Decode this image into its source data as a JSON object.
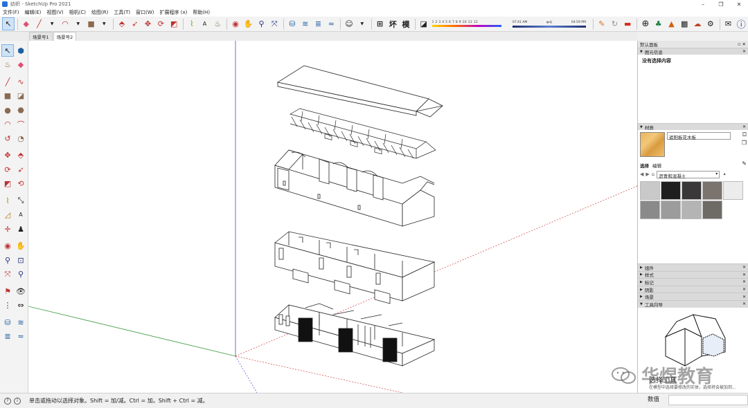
{
  "window": {
    "title": "纺织 - SketchUp Pro 2021",
    "controls": [
      "–",
      "❐",
      "✕"
    ]
  },
  "menu": [
    "文件(F)",
    "编辑(E)",
    "视图(V)",
    "相机(C)",
    "绘图(R)",
    "工具(T)",
    "窗口(W)",
    "扩展程序 (x)",
    "帮助(H)"
  ],
  "toolbar": {
    "shadow_months": "1 2 3 4 5 6 7 8 9 10 11 12",
    "time_start": "07:41 AM",
    "time_mid": "中午",
    "time_end": "04:59 PM",
    "text_buttons": [
      "⊞",
      "坏",
      "模"
    ]
  },
  "scene_tabs": [
    "场景号1",
    "场景号2"
  ],
  "tray": {
    "title": "默认面板",
    "entity_info": {
      "header": "图元信息",
      "body": "没有选择内容"
    },
    "materials": {
      "header": "材质",
      "name": "遮阳板花木板",
      "tabs": [
        "选择",
        "编辑"
      ],
      "library": "沥青和混凝土",
      "swatches": [
        "#c9c9c9",
        "#1f1f1f",
        "#3a3838",
        "#7a736e",
        "#ececec",
        "#8a8a8a",
        "#9c9c9c",
        "#b4b4b4",
        "#6e6a66"
      ]
    },
    "collapsed_panels": [
      "组件",
      "样式",
      "标记",
      "阴影",
      "场景",
      "工具向导"
    ],
    "instructor": {
      "caption": "选择工具",
      "desc": "在模型中选择要修改的实体，选择将会被加到..."
    }
  },
  "status": {
    "message": "单击或拖动以选择对象。Shift = 加/减。Ctrl = 加。Shift + Ctrl = 减。",
    "vcb_label": "数值"
  },
  "watermark": "华煜教育",
  "colors": {
    "select_highlight": "#cfe3f7",
    "axis_red": "#d04040",
    "axis_green": "#3a9a3a",
    "axis_blue": "#4040c0"
  }
}
